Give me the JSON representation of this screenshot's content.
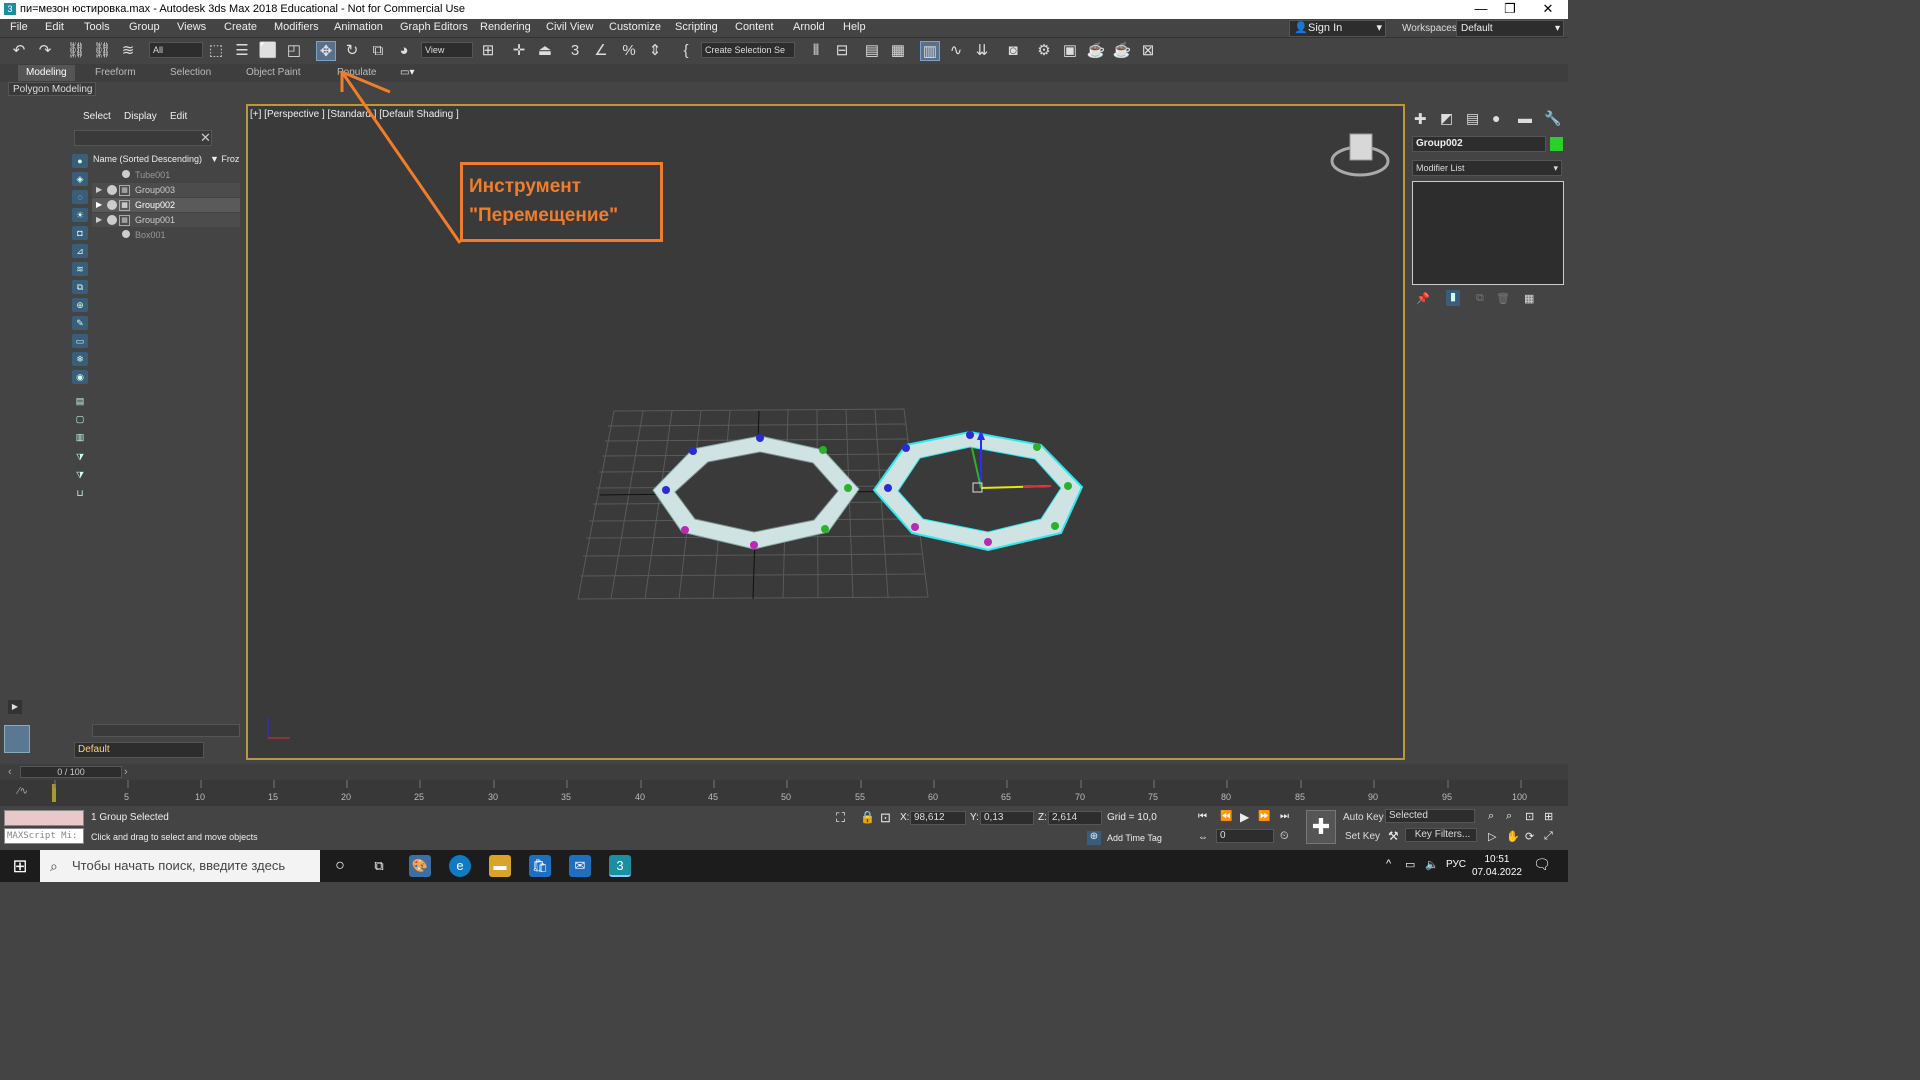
{
  "window": {
    "title": "пи=мезон юстировка.max - Autodesk 3ds Max 2018 Educational - Not for Commercial Use",
    "minimize": "—",
    "restore": "❐",
    "close": "✕"
  },
  "menu": [
    "File",
    "Edit",
    "Tools",
    "Group",
    "Views",
    "Create",
    "Modifiers",
    "Animation",
    "Graph Editors",
    "Rendering",
    "Civil View",
    "Customize",
    "Scripting",
    "Content",
    "Arnold",
    "Help"
  ],
  "signin": "Sign In",
  "workspaces": {
    "label": "Workspaces:",
    "value": "Default"
  },
  "toolbar": {
    "filter": "All",
    "refcoord": "View",
    "selection_set": "Create Selection Se"
  },
  "ribbon": {
    "tabs": [
      "Modeling",
      "Freeform",
      "Selection",
      "Object Paint",
      "Populate"
    ],
    "active": "Modeling",
    "panel": "Polygon Modeling"
  },
  "scene_explorer": {
    "menus": [
      "Select",
      "Display",
      "Edit"
    ],
    "header": {
      "name": "Name (Sorted Descending)",
      "frozen": "▼ Froz"
    },
    "items": [
      {
        "name": "Tube001",
        "type": "object"
      },
      {
        "name": "Group003",
        "type": "group"
      },
      {
        "name": "Group002",
        "type": "group",
        "selected": true
      },
      {
        "name": "Group001",
        "type": "group"
      },
      {
        "name": "Box001",
        "type": "object"
      }
    ],
    "layer": "Default"
  },
  "viewport": {
    "label": "[+] [Perspective ] [Standard ] [Default Shading ]"
  },
  "annotation": {
    "line1": "Инструмент",
    "line2": "\"Перемещение\"",
    "color": "#f07d2b"
  },
  "command_panel": {
    "object_name": "Group002",
    "object_color": "#2bd12b",
    "modifier_list": "Modifier List"
  },
  "time_slider": {
    "value": "0 / 100"
  },
  "trackbar": {
    "ticks": [
      "5",
      "10",
      "15",
      "20",
      "25",
      "30",
      "35",
      "40",
      "45",
      "50",
      "55",
      "60",
      "65",
      "70",
      "75",
      "80",
      "85",
      "90",
      "95",
      "100"
    ]
  },
  "status": {
    "selection": "1 Group Selected",
    "prompt": "Click and drag to select and move objects",
    "maxscript": "MAXScript Mi:",
    "x_label": "X:",
    "x": "98,612",
    "y_label": "Y:",
    "y": "0,13",
    "z_label": "Z:",
    "z": "2,614",
    "grid": "Grid = 10,0",
    "add_time_tag": "Add Time Tag",
    "auto_key": "Auto Key",
    "set_key": "Set Key",
    "selected": "Selected",
    "key_filters": "Key Filters...",
    "frame": "0"
  },
  "taskbar": {
    "search": "Чтобы начать поиск, введите здесь",
    "lang": "РУС",
    "time": "10:51",
    "date": "07.04.2022"
  }
}
